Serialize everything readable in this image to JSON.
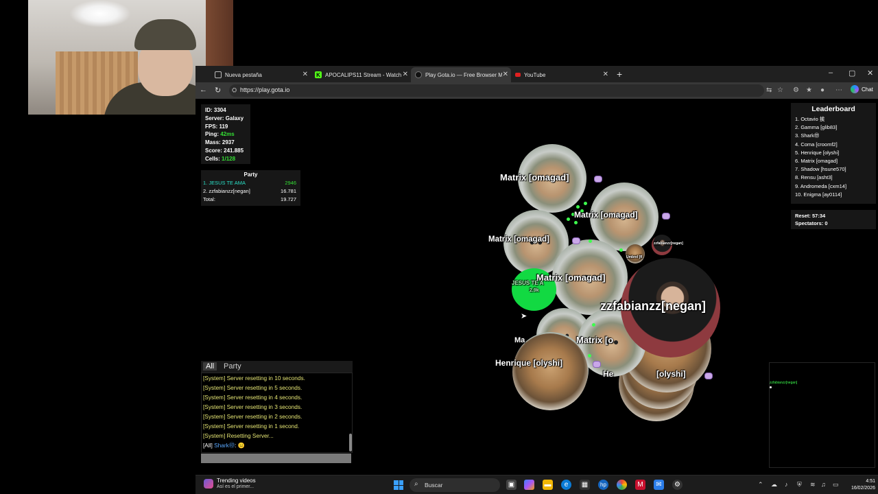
{
  "browser": {
    "tabs": [
      {
        "title": "Nueva pestaña",
        "active": false
      },
      {
        "title": "APOCALIPS11 Stream - Watch Live",
        "active": false
      },
      {
        "title": "Play Gota.io — Free Browser Multi",
        "active": true
      },
      {
        "title": "YouTube",
        "active": false
      }
    ],
    "url": "https://play.gota.io",
    "chat_label": "Chat"
  },
  "game": {
    "stats": {
      "id": "ID: 3304",
      "server": "Server: Galaxy",
      "fps": "FPS: 119",
      "ping_label": "Ping: ",
      "ping_value": "42ms",
      "mass": "Mass: 2937",
      "score": "Score: 241.885",
      "cells_label": "Cells: ",
      "cells_value": "1/128"
    },
    "party": {
      "title": "Party",
      "rows": [
        {
          "name": "1. JESUS TE AMA",
          "value": "2946"
        },
        {
          "name": "2. zzfabianzz[negan]",
          "value": "16.781"
        },
        {
          "name": "Total:",
          "value": "19.727"
        }
      ]
    },
    "leaderboard": {
      "title": "Leaderboard",
      "entries": [
        "1. Octavio 挨",
        "2. Gamma [glib83]",
        "3. Shark㊞",
        "4. Coma [croomf2]",
        "5. Henrique [olyshi]",
        "6. Matrix [omagad]",
        "7. Shadow [hsune570]",
        "8. Rensu [asht3]",
        "9. Andromeda [cxm14]",
        "10. Enigma [ay0114]"
      ],
      "reset": "Reset: 57:34",
      "spectators": "Spectators: 0"
    },
    "cells": {
      "matrix_1": "Matrix [omagad]",
      "matrix_2": "Matrix [omagad]",
      "matrix_3": "Matrix [omagad]",
      "matrix_4": "Matrix [omagad]",
      "matrix_5": "Matrix [o",
      "matrix_6": "Ma",
      "henrique_1": "Henrique [olyshi]",
      "henrique_2": "He",
      "henrique_3": "[olyshi]",
      "negan": "zzfabianzz[negan]",
      "negan_small": "zzfabianzz[negan]",
      "umbrel": "Umbrel [fl",
      "jesus": "JESUS TE A",
      "jesus_mass": "2.9k"
    },
    "chat": {
      "tabs": [
        "All",
        "Party"
      ],
      "messages": [
        "[System] Server resetting in 10 seconds.",
        "[System] Server resetting in 5 seconds.",
        "[System] Server resetting in 4 seconds.",
        "[System] Server resetting in 3 seconds.",
        "[System] Server resetting in 2 seconds.",
        "[System] Server resetting in 1 second.",
        "[System] Resetting Server..."
      ],
      "last_prefix": "[All] ",
      "last_user": "Shark㊞",
      "last_sep": ": "
    },
    "minimap_label": "zzfabianzz[negan]"
  },
  "taskbar": {
    "widget_title": "Trending videos",
    "widget_sub": "Así es el primer...",
    "search_placeholder": "Buscar",
    "time": "4:51",
    "date": "16/02/2026"
  }
}
